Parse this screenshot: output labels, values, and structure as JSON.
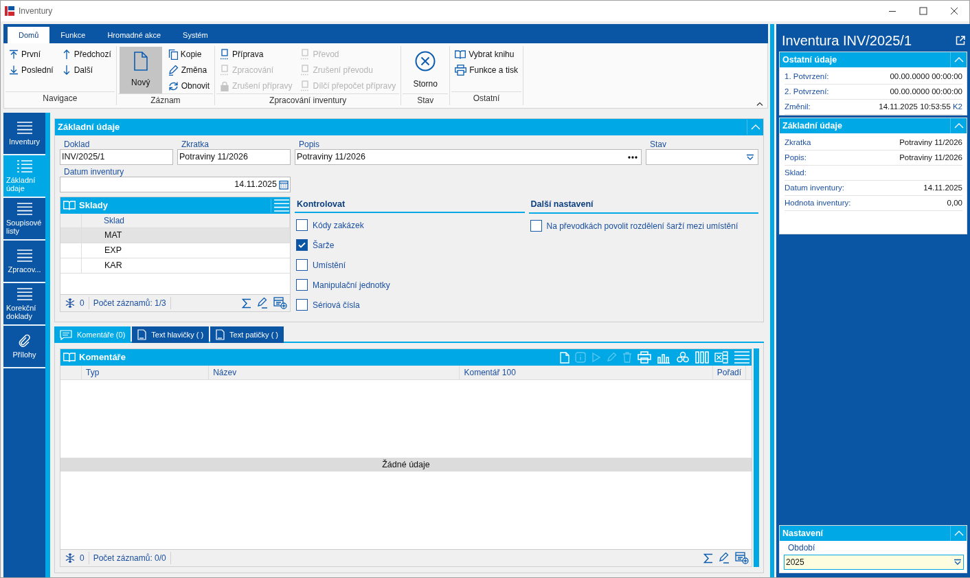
{
  "window": {
    "title": "Inventury"
  },
  "ribbon": {
    "tabs": [
      {
        "label": "Domů",
        "selected": true
      },
      {
        "label": "Funkce",
        "selected": false
      },
      {
        "label": "Hromadné akce",
        "selected": false
      },
      {
        "label": "Systém",
        "selected": false
      }
    ],
    "groups": [
      {
        "label": "Navigace",
        "columns": [
          [
            {
              "label": "První",
              "kind": "small",
              "disabled": false,
              "highlighted": false
            },
            {
              "label": "Poslední",
              "kind": "small",
              "disabled": false,
              "highlighted": false
            }
          ],
          [
            {
              "label": "Předchozí",
              "kind": "small",
              "disabled": false,
              "highlighted": false
            },
            {
              "label": "Další",
              "kind": "small",
              "disabled": false,
              "highlighted": false
            }
          ]
        ]
      },
      {
        "label": "Záznam",
        "columns": [
          [
            {
              "label": "Nový",
              "kind": "large",
              "disabled": false,
              "highlighted": true
            }
          ],
          [
            {
              "label": "Kopie",
              "kind": "small",
              "disabled": false,
              "highlighted": false
            },
            {
              "label": "Změna",
              "kind": "small",
              "disabled": false,
              "highlighted": false
            },
            {
              "label": "Obnovit",
              "kind": "small",
              "disabled": false,
              "highlighted": false
            }
          ]
        ]
      },
      {
        "label": "Zpracování inventury",
        "columns": [
          [
            {
              "label": "Příprava",
              "kind": "small",
              "disabled": false,
              "highlighted": false
            },
            {
              "label": "Zpracování",
              "kind": "small",
              "disabled": true,
              "highlighted": false
            },
            {
              "label": "Zrušení přípravy",
              "kind": "small",
              "disabled": true,
              "highlighted": false
            }
          ],
          [
            {
              "label": "Převod",
              "kind": "small",
              "disabled": true,
              "highlighted": false
            },
            {
              "label": "Zrušení převodu",
              "kind": "small",
              "disabled": true,
              "highlighted": false
            },
            {
              "label": "Dílčí přepočet přípravy",
              "kind": "small",
              "disabled": true,
              "highlighted": false
            }
          ]
        ]
      },
      {
        "label": "Stav",
        "columns": [
          [
            {
              "label": "Storno",
              "kind": "large",
              "disabled": false,
              "highlighted": false
            }
          ]
        ]
      },
      {
        "label": "Ostatní",
        "columns": [
          [
            {
              "label": "Vybrat knihu",
              "kind": "small",
              "disabled": false,
              "highlighted": false
            },
            {
              "label": "Funkce a tisk",
              "kind": "small",
              "disabled": false,
              "highlighted": false
            }
          ]
        ]
      }
    ]
  },
  "navigation": {
    "items": [
      {
        "label": "Inventury",
        "selected": false
      },
      {
        "label": "Základní údaje",
        "selected": true
      },
      {
        "label": "Soupisové listy",
        "selected": false
      },
      {
        "label": "Zpracov...",
        "selected": false
      },
      {
        "label": "Korekční doklady",
        "selected": false
      },
      {
        "label": "Přílohy",
        "selected": false
      }
    ]
  },
  "form": {
    "title": "Základní údaje",
    "fields": [
      {
        "label": "Doklad",
        "value": "INV/2025/1"
      },
      {
        "label": "Zkratka",
        "value": "Potraviny 11/2026"
      },
      {
        "label": "Popis",
        "value": "Potraviny 11/2026"
      },
      {
        "label": "Stav"
      }
    ],
    "date_field": {
      "label": "Datum inventury",
      "value": "14.11.2025"
    },
    "warehouses": {
      "title": "Sklady",
      "columns": [
        "Sklad"
      ],
      "rows": [
        {
          "cells": [
            "MAT"
          ],
          "selected": true
        },
        {
          "cells": [
            "EXP"
          ],
          "selected": false
        },
        {
          "cells": [
            "KAR"
          ],
          "selected": false
        }
      ],
      "footer": {
        "count": "0",
        "records": "Počet záznamů: 1/3"
      }
    },
    "check_groups": [
      {
        "title": "Kontrolovat",
        "items": [
          {
            "label": "Kódy zakázek",
            "checked": false
          },
          {
            "label": "Šarže",
            "checked": true
          },
          {
            "label": "Umístění",
            "checked": false
          },
          {
            "label": "Manipulační jednotky",
            "checked": false
          },
          {
            "label": "Sériová čísla",
            "checked": false
          }
        ]
      },
      {
        "title": "Další nastavení",
        "items": [
          {
            "label": "Na převodkách povolit rozdělení šarží mezi umístění",
            "checked": false
          }
        ]
      }
    ]
  },
  "detail_tabs": [
    {
      "label": "Komentáře (0)",
      "selected": true
    },
    {
      "label": "Text hlavičky ( )",
      "selected": false
    },
    {
      "label": "Text patičky ( )",
      "selected": false
    }
  ],
  "comments": {
    "title": "Komentáře",
    "toolbar": [
      {
        "disabled": false
      },
      {
        "disabled": true
      },
      {
        "disabled": true
      },
      {
        "disabled": true
      },
      {
        "disabled": true
      },
      {
        "disabled": false
      },
      {
        "disabled": false
      },
      {
        "disabled": false
      },
      {
        "disabled": false
      },
      {
        "disabled": false
      }
    ],
    "columns": [
      "Typ",
      "Název",
      "Komentář 100",
      "Pořadí"
    ],
    "empty_message": "Žádné údaje",
    "footer": {
      "count": "0",
      "records": "Počet záznamů: 0/0"
    }
  },
  "side_panel": {
    "title": "Inventura INV/2025/1",
    "sections": [
      {
        "title": "Ostatní údaje",
        "rows": [
          {
            "label": "1. Potvrzení:",
            "value": "00.00.0000 00:00:00"
          },
          {
            "label": "2. Potvrzení:",
            "value": "00.00.0000 00:00:00"
          },
          {
            "label": "Změnil:",
            "value": "14.11.2025 10:53:55",
            "user": "K2"
          }
        ]
      },
      {
        "title": "Základní údaje",
        "rows": [
          {
            "label": "Zkratka",
            "value": "Potraviny 11/2026"
          },
          {
            "label": "Popis:",
            "value": "Potraviny 11/2026"
          },
          {
            "label": "Sklad:"
          },
          {
            "label": "Datum inventury:",
            "value": "14.11.2025"
          },
          {
            "label": "Hodnota inventury:",
            "value": "0,00"
          }
        ]
      }
    ],
    "settings": {
      "title": "Nastavení",
      "field": {
        "label": "Období",
        "value": "2025"
      }
    }
  }
}
